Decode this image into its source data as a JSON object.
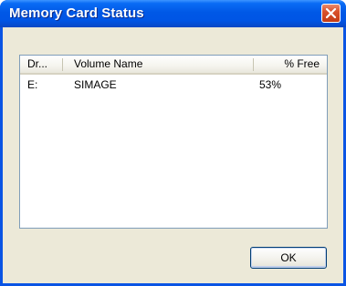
{
  "window": {
    "title": "Memory Card Status",
    "close_icon": "close-icon"
  },
  "list": {
    "columns": [
      {
        "label": "Dr..."
      },
      {
        "label": "Volume Name"
      },
      {
        "label": "% Free"
      }
    ],
    "rows": [
      {
        "drive": "E:",
        "volume": "SIMAGE",
        "free": "53%"
      }
    ]
  },
  "buttons": {
    "ok_label": "OK"
  },
  "colors": {
    "titlebar": "#0058e6",
    "close_button": "#d9512b",
    "dialog_face": "#ece9d8"
  }
}
